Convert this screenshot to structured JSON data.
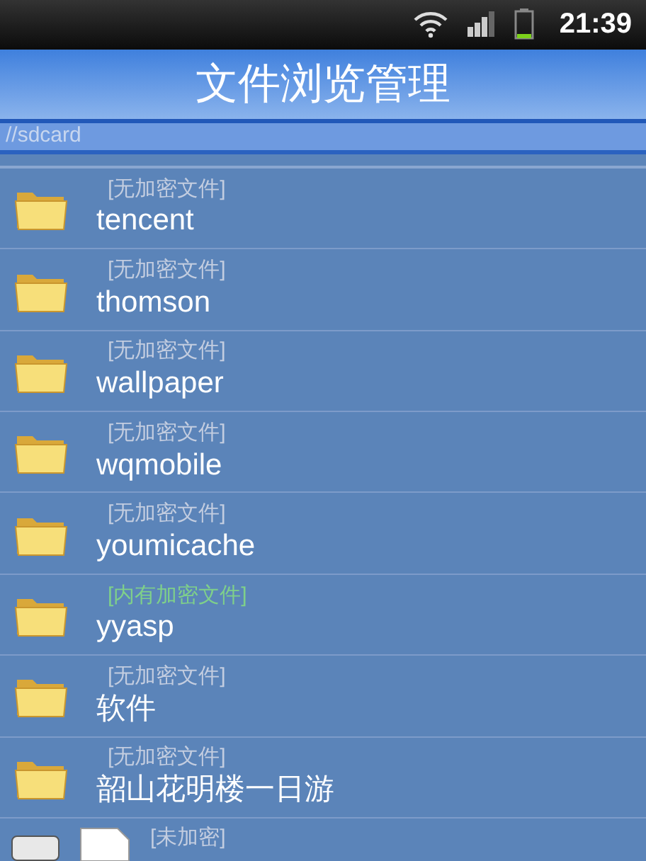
{
  "status_bar": {
    "time": "21:39"
  },
  "title": "文件浏览管理",
  "path": "//sdcard",
  "items": [
    {
      "kind": "folder",
      "tag": "[无加密文件]",
      "encrypted": false,
      "name": "tencent"
    },
    {
      "kind": "folder",
      "tag": "[无加密文件]",
      "encrypted": false,
      "name": "thomson"
    },
    {
      "kind": "folder",
      "tag": "[无加密文件]",
      "encrypted": false,
      "name": "wallpaper"
    },
    {
      "kind": "folder",
      "tag": "[无加密文件]",
      "encrypted": false,
      "name": "wqmobile"
    },
    {
      "kind": "folder",
      "tag": "[无加密文件]",
      "encrypted": false,
      "name": "youmicache"
    },
    {
      "kind": "folder",
      "tag": "[内有加密文件]",
      "encrypted": true,
      "name": "yyasp"
    },
    {
      "kind": "folder",
      "tag": "[无加密文件]",
      "encrypted": false,
      "name": "软件"
    },
    {
      "kind": "folder",
      "tag": "[无加密文件]",
      "encrypted": false,
      "name": "韶山花明楼一日游"
    },
    {
      "kind": "file",
      "tag": "[未加密]",
      "encrypted": false,
      "checked": false
    }
  ]
}
